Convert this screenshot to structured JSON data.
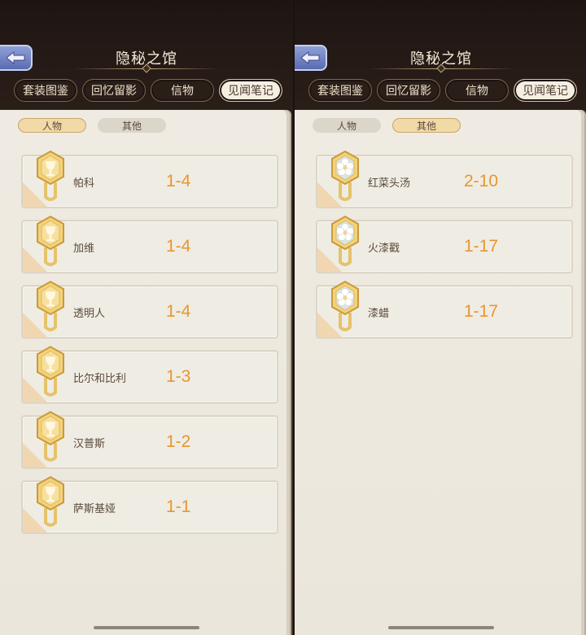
{
  "colors": {
    "accent_level": "#e8962e",
    "paper": "#efebe2",
    "frame": "#3a2a22"
  },
  "panels": [
    {
      "title": "隐秘之馆",
      "back_icon": "back-arrow-icon",
      "tabs": [
        "套装图鉴",
        "回忆留影",
        "信物",
        "见闻笔记"
      ],
      "active_tab": 3,
      "subtabs": [
        "人物",
        "其他"
      ],
      "active_subtab": 0,
      "items": [
        {
          "name": "帕科",
          "level": "1-4",
          "icon": "trophy-badge-icon"
        },
        {
          "name": "加维",
          "level": "1-4",
          "icon": "trophy-badge-icon"
        },
        {
          "name": "透明人",
          "level": "1-4",
          "icon": "trophy-badge-icon"
        },
        {
          "name": "比尔和比利",
          "level": "1-3",
          "icon": "trophy-badge-icon"
        },
        {
          "name": "汉普斯",
          "level": "1-2",
          "icon": "trophy-badge-icon"
        },
        {
          "name": "萨斯基娅",
          "level": "1-1",
          "icon": "trophy-badge-icon"
        }
      ]
    },
    {
      "title": "隐秘之馆",
      "back_icon": "back-arrow-icon",
      "tabs": [
        "套装图鉴",
        "回忆留影",
        "信物",
        "见闻笔记"
      ],
      "active_tab": 3,
      "subtabs": [
        "人物",
        "其他"
      ],
      "active_subtab": 1,
      "items": [
        {
          "name": "红菜头汤",
          "level": "2-10",
          "icon": "flower-badge-icon"
        },
        {
          "name": "火漆戳",
          "level": "1-17",
          "icon": "flower-badge-icon"
        },
        {
          "name": "漆蜡",
          "level": "1-17",
          "icon": "flower-badge-icon"
        }
      ]
    }
  ]
}
